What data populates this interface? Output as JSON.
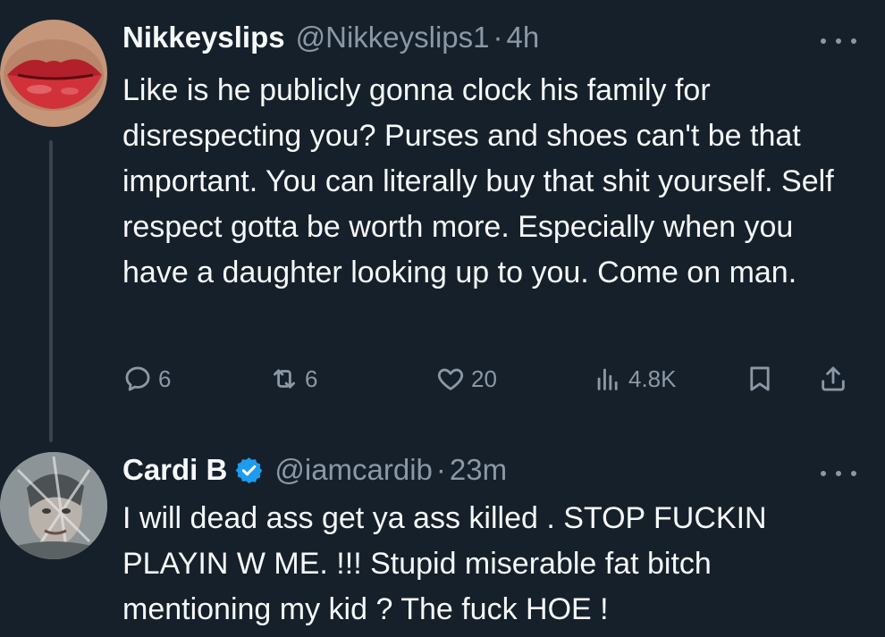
{
  "tweets": [
    {
      "name": "Nikkeyslips",
      "handle": "@Nikkeyslips1",
      "separator": "·",
      "time": "4h",
      "text": "Like is he publicly gonna clock his family for disrespecting you? Purses and shoes can't be that important. You can literally buy that shit yourself. Self respect gotta be worth more. Especially when you have a daughter looking up to you. Come on man.",
      "actions": {
        "replies": "6",
        "reposts": "6",
        "likes": "20",
        "views": "4.8K"
      }
    },
    {
      "name": "Cardi B",
      "handle": "@iamcardib",
      "separator": "·",
      "time": "23m",
      "text": "I will dead ass get ya ass killed . STOP FUCKIN PLAYIN W ME. !!! Stupid miserable fat bitch mentioning my kid ? The fuck HOE !"
    }
  ],
  "colors": {
    "background": "#15202b",
    "text": "#f7f9f9",
    "muted": "#8b98a5",
    "verified": "#1d9bf0"
  }
}
